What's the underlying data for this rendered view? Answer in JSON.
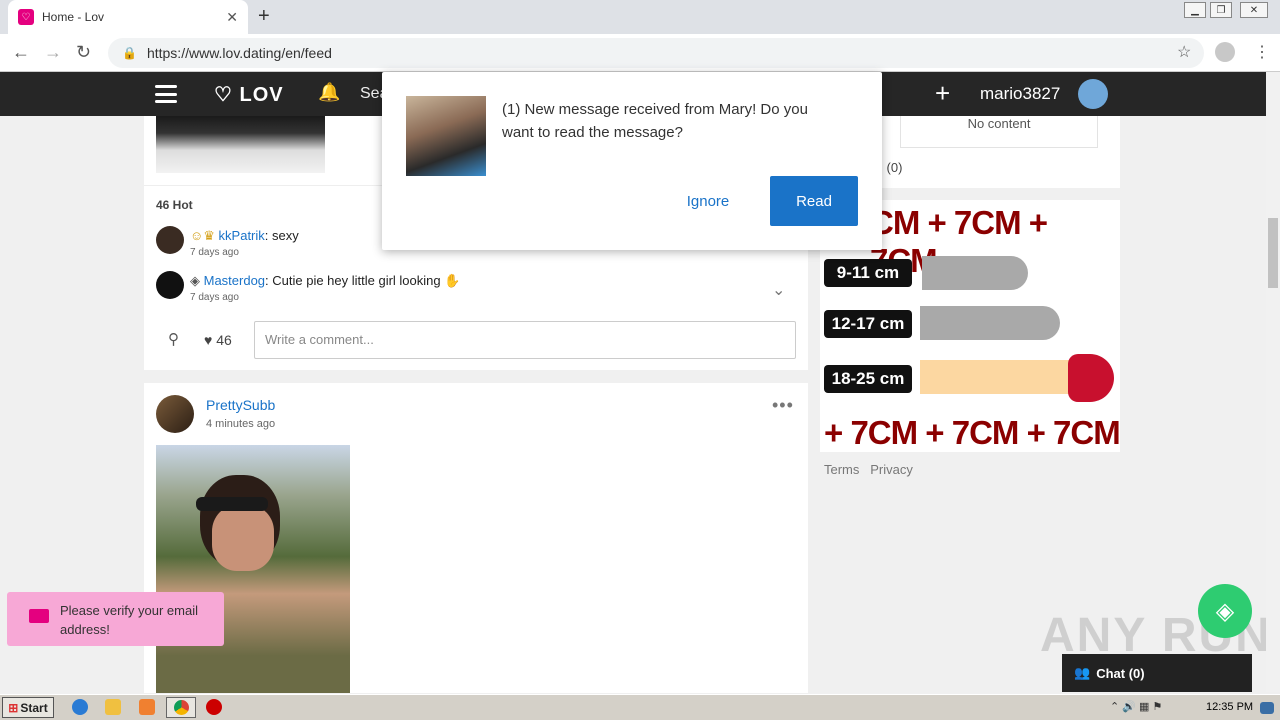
{
  "browser": {
    "tab_title": "Home - Lov",
    "url": "https://www.lov.dating/en/feed"
  },
  "header": {
    "logo": "LOV",
    "search_label": "Sea",
    "username": "mario3827"
  },
  "post1": {
    "hot_label": "46 Hot",
    "comments": [
      {
        "user": "kkPatrik",
        "text": ": sexy",
        "time": "7 days ago"
      },
      {
        "user": "Masterdog",
        "text": ": Cutie pie hey little girl looking",
        "time": "7 days ago"
      }
    ],
    "likes": "46",
    "comment_placeholder": "Write a comment..."
  },
  "post2": {
    "user": "PrettySubb",
    "time": "4 minutes ago"
  },
  "sidebar": {
    "no_content": "No content",
    "count_link": "l",
    "count": "(0)",
    "terms": "Terms",
    "privacy": "Privacy"
  },
  "promo": {
    "top_text": "CM + 7CM + 7CM",
    "bottom_text": "+ 7CM + 7CM + 7CM",
    "rows": [
      {
        "label": "9-11 cm",
        "color": "#a9a9a9"
      },
      {
        "label": "12-17 cm",
        "color": "#a9a9a9"
      },
      {
        "label": "18-25 cm",
        "color": "#fcd7a1"
      }
    ]
  },
  "dialog": {
    "message": "(1) New message received from Mary! Do you want to read the message?",
    "ignore": "Ignore",
    "read": "Read"
  },
  "toast": {
    "text": "Please verify your email address!"
  },
  "chat": {
    "label": "Chat (0)"
  },
  "watermark": "ANY RUN",
  "taskbar": {
    "start": "Start",
    "clock": "12:35 PM"
  }
}
